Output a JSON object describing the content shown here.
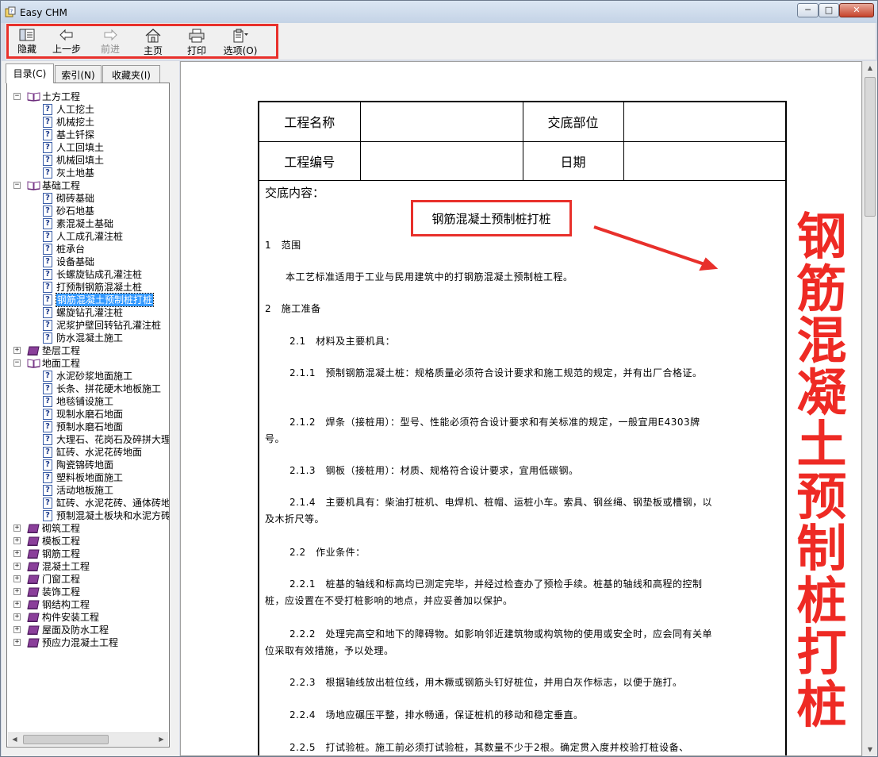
{
  "window": {
    "title": "Easy CHM",
    "controls": {
      "minimize": "─",
      "maximize": "□",
      "close": "✕"
    }
  },
  "toolbar": {
    "hide": "隐藏",
    "back": "上一步",
    "forward": "前进",
    "home": "主页",
    "print": "打印",
    "options": "选项(O)"
  },
  "tabs": {
    "contents": "目录(C)",
    "index": "索引(N)",
    "favorites": "收藏夹(I)"
  },
  "tree": [
    {
      "type": "book",
      "open": true,
      "label": "土方工程"
    },
    {
      "type": "page",
      "label": "人工挖土"
    },
    {
      "type": "page",
      "label": "机械挖土"
    },
    {
      "type": "page",
      "label": "基土钎探"
    },
    {
      "type": "page",
      "label": "人工回填土"
    },
    {
      "type": "page",
      "label": "机械回填土"
    },
    {
      "type": "page",
      "label": "灰土地基"
    },
    {
      "type": "book",
      "open": true,
      "label": "基础工程"
    },
    {
      "type": "page",
      "label": "砌砖基础"
    },
    {
      "type": "page",
      "label": "砂石地基"
    },
    {
      "type": "page",
      "label": "素混凝土基础"
    },
    {
      "type": "page",
      "label": "人工成孔灌注桩"
    },
    {
      "type": "page",
      "label": "桩承台"
    },
    {
      "type": "page",
      "label": "设备基础"
    },
    {
      "type": "page",
      "label": "长螺旋钻成孔灌注桩"
    },
    {
      "type": "page",
      "label": "打预制钢筋混凝土桩"
    },
    {
      "type": "page",
      "label": "钢筋混凝土预制桩打桩",
      "selected": true
    },
    {
      "type": "page",
      "label": "螺旋钻孔灌注桩"
    },
    {
      "type": "page",
      "label": "泥浆护壁回转钻孔灌注桩"
    },
    {
      "type": "page",
      "label": "防水混凝土施工"
    },
    {
      "type": "book",
      "open": false,
      "label": "垫层工程"
    },
    {
      "type": "book",
      "open": true,
      "label": "地面工程"
    },
    {
      "type": "page",
      "label": "水泥砂浆地面施工"
    },
    {
      "type": "page",
      "label": "长条、拼花硬木地板施工"
    },
    {
      "type": "page",
      "label": "地毯铺设施工"
    },
    {
      "type": "page",
      "label": "现制水磨石地面"
    },
    {
      "type": "page",
      "label": "预制水磨石地面"
    },
    {
      "type": "page",
      "label": "大理石、花岗石及碎拼大理"
    },
    {
      "type": "page",
      "label": "缸砖、水泥花砖地面"
    },
    {
      "type": "page",
      "label": "陶瓷锦砖地面"
    },
    {
      "type": "page",
      "label": "塑料板地面施工"
    },
    {
      "type": "page",
      "label": "活动地板施工"
    },
    {
      "type": "page",
      "label": "缸砖、水泥花砖、通体砖地"
    },
    {
      "type": "page",
      "label": "预制混凝土板块和水泥方砖"
    },
    {
      "type": "book",
      "open": false,
      "label": "砌筑工程"
    },
    {
      "type": "book",
      "open": false,
      "label": "模板工程"
    },
    {
      "type": "book",
      "open": false,
      "label": "钢筋工程"
    },
    {
      "type": "book",
      "open": false,
      "label": "混凝土工程"
    },
    {
      "type": "book",
      "open": false,
      "label": "门窗工程"
    },
    {
      "type": "book",
      "open": false,
      "label": "装饰工程"
    },
    {
      "type": "book",
      "open": false,
      "label": "钢结构工程"
    },
    {
      "type": "book",
      "open": false,
      "label": "构件安装工程"
    },
    {
      "type": "book",
      "open": false,
      "label": "屋面及防水工程"
    },
    {
      "type": "book",
      "open": false,
      "label": "预应力混凝土工程"
    }
  ],
  "document": {
    "header": {
      "project_name": "工程名称",
      "disclosure_part": "交底部位",
      "project_no": "工程编号",
      "date": "日期"
    },
    "body_label": "交底内容：",
    "title": "钢筋混凝土预制桩打桩",
    "paragraphs": [
      {
        "cls": "",
        "top": 0,
        "text": "1　范围"
      },
      {
        "cls": "i1",
        "text": "本工艺标准适用于工业与民用建筑中的打钢筋混凝土预制桩工程。"
      },
      {
        "cls": "",
        "text": "2　施工准备"
      },
      {
        "cls": "i2",
        "text": "2.1　材料及主要机具："
      },
      {
        "cls": "i2",
        "text": "2.1.1　预制钢筋混凝土桩：规格质量必须符合设计要求和施工规范的规定，并有出厂合格证。"
      },
      {
        "cls": "i2",
        "text": "2.1.2　焊条（接桩用）：型号、性能必须符合设计要求和有关标准的规定，一般宜用E4303牌号。"
      },
      {
        "cls": "i2",
        "text": "2.1.3　钢板（接桩用）：材质、规格符合设计要求，宜用低碳钢。"
      },
      {
        "cls": "i2",
        "text": "2.1.4　主要机具有：柴油打桩机、电焊机、桩帽、运桩小车。索具、钢丝绳、钢垫板或槽钢，以及木折尺等。"
      },
      {
        "cls": "i2",
        "text": "2.2　作业条件："
      },
      {
        "cls": "i2",
        "text": "2.2.1　桩基的轴线和标高均已测定完毕，并经过检查办了预检手续。桩基的轴线和高程的控制桩，应设置在不受打桩影响的地点，并应妥善加以保护。"
      },
      {
        "cls": "i2",
        "text": "2.2.2　处理完高空和地下的障碍物。如影响邻近建筑物或构筑物的使用或安全时，应会同有关单位采取有效措施，予以处理。"
      },
      {
        "cls": "i2",
        "text": "2.2.3　根据轴线放出桩位线，用木橛或钢筋头钉好桩位，并用白灰作标志，以便于施打。"
      },
      {
        "cls": "i2",
        "text": "2.2.4　场地应碾压平整，排水畅通，保证桩机的移动和稳定垂直。"
      },
      {
        "cls": "i2",
        "text": "2.2.5　打试验桩。施工前必须打试验桩，其数量不少于2根。确定贯入度并校验打桩设备、"
      }
    ]
  },
  "annotation": {
    "caption": "钢筋混凝土预制桩打桩",
    "color": "#ee2a24"
  }
}
